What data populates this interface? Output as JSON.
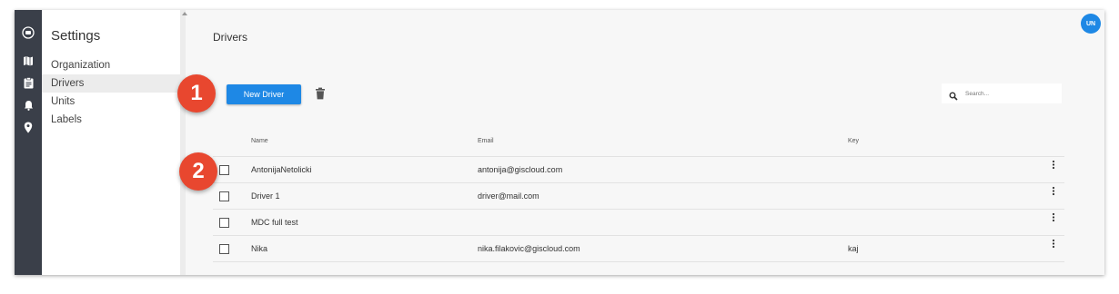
{
  "settings": {
    "title": "Settings",
    "menu": [
      {
        "label": "Organization",
        "active": false
      },
      {
        "label": "Drivers",
        "active": true
      },
      {
        "label": "Units",
        "active": false
      },
      {
        "label": "Labels",
        "active": false
      }
    ]
  },
  "page": {
    "title": "Drivers",
    "new_button_label": "New Driver",
    "search_placeholder": "Search..."
  },
  "table": {
    "headers": {
      "name": "Name",
      "email": "Email",
      "key": "Key"
    },
    "rows": [
      {
        "name": "AntonijaNetolicki",
        "email": "antonija@giscloud.com",
        "key": ""
      },
      {
        "name": "Driver 1",
        "email": "driver@mail.com",
        "key": ""
      },
      {
        "name": "MDC full test",
        "email": "",
        "key": ""
      },
      {
        "name": "Nika",
        "email": "nika.filakovic@giscloud.com",
        "key": "kaj"
      }
    ]
  },
  "user": {
    "initials": "UN"
  },
  "callouts": [
    "1",
    "2"
  ],
  "colors": {
    "accent": "#1e88e5",
    "callout": "#e8472f",
    "rail": "#3a3f49"
  },
  "icons": {
    "rail": [
      "car-icon",
      "map-icon",
      "clipboard-icon",
      "bell-icon",
      "location-pin-icon"
    ],
    "toolbar": [
      "trash-icon",
      "search-icon"
    ],
    "row_menu": "more-vertical-icon"
  }
}
